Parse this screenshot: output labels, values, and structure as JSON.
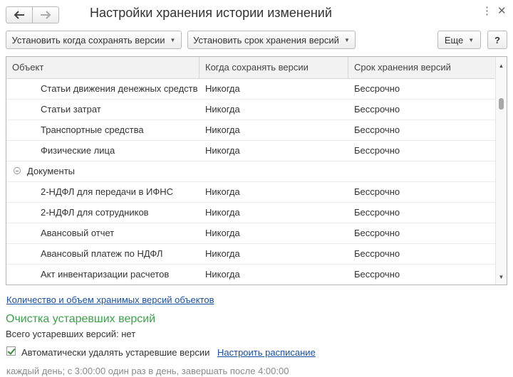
{
  "window": {
    "title": "Настройки хранения истории изменений",
    "menu_icon": "more-vertical-icon",
    "close_icon": "close-icon"
  },
  "nav": {
    "back_icon": "arrow-left-icon",
    "forward_icon": "arrow-right-icon"
  },
  "toolbar": {
    "when_save_label": "Установить когда сохранять версии",
    "storage_term_label": "Установить срок хранения версий",
    "more_label": "Еще",
    "help_label": "?"
  },
  "table": {
    "columns": [
      "Объект",
      "Когда сохранять версии",
      "Срок хранения версий"
    ],
    "rows": [
      {
        "object": "Статьи движения денежных средств",
        "when": "Никогда",
        "term": "Бессрочно"
      },
      {
        "object": "Статьи затрат",
        "when": "Никогда",
        "term": "Бессрочно"
      },
      {
        "object": "Транспортные средства",
        "when": "Никогда",
        "term": "Бессрочно"
      },
      {
        "object": "Физические лица",
        "when": "Никогда",
        "term": "Бессрочно"
      },
      {
        "object": "Документы",
        "group": true
      },
      {
        "object": "2-НДФЛ для передачи в ИФНС",
        "when": "Никогда",
        "term": "Бессрочно"
      },
      {
        "object": "2-НДФЛ для сотрудников",
        "when": "Никогда",
        "term": "Бессрочно"
      },
      {
        "object": "Авансовый отчет",
        "when": "Никогда",
        "term": "Бессрочно"
      },
      {
        "object": "Авансовый платеж по НДФЛ",
        "when": "Никогда",
        "term": "Бессрочно"
      },
      {
        "object": "Акт инвентаризации расчетов",
        "when": "Никогда",
        "term": "Бессрочно"
      }
    ]
  },
  "versions_link": "Количество и объем хранимых версий объектов",
  "cleanup": {
    "title": "Очистка устаревших версий",
    "total_text": "Всего устаревших версий: нет",
    "auto_delete_label": "Автоматически удалять устаревшие версии",
    "auto_delete_checked": true,
    "schedule_link": "Настроить расписание",
    "schedule_text": "каждый день; с 3:00:00 один раз в день, завершать после 4:00:00"
  }
}
